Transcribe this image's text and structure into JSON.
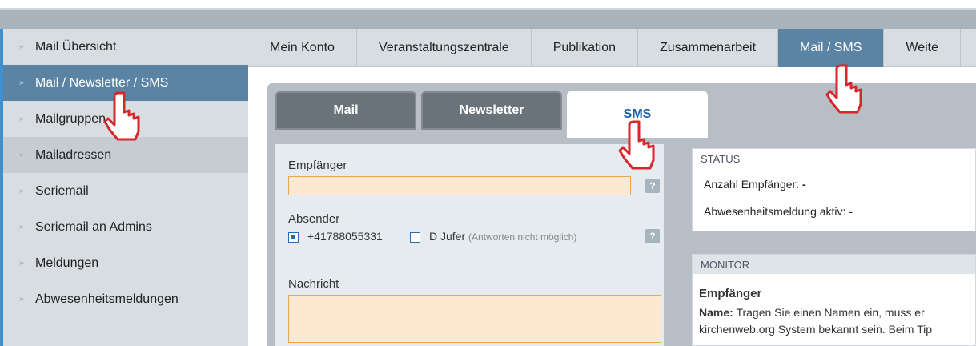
{
  "sidebar": {
    "items": [
      {
        "label": "Mail Übersicht"
      },
      {
        "label": "Mail / Newsletter / SMS"
      },
      {
        "label": "Mailgruppen"
      },
      {
        "label": "Mailadressen"
      },
      {
        "label": "Seriemail"
      },
      {
        "label": "Seriemail an Admins"
      },
      {
        "label": "Meldungen"
      },
      {
        "label": "Abwesenheitsmeldungen"
      }
    ]
  },
  "topnav": {
    "tabs": [
      {
        "label": "Mein Konto"
      },
      {
        "label": "Veranstaltungszentrale"
      },
      {
        "label": "Publikation"
      },
      {
        "label": "Zusammenarbeit"
      },
      {
        "label": "Mail / SMS"
      },
      {
        "label": "Weite"
      }
    ]
  },
  "subtabs": {
    "mail": "Mail",
    "newsletter": "Newsletter",
    "sms": "SMS"
  },
  "form": {
    "recipient_label": "Empfänger",
    "recipient_value": "",
    "sender_label": "Absender",
    "sender_option1": "+41788055331",
    "sender_option2": "D Jufer",
    "sender_option2_hint": "(Antworten nicht möglich)",
    "message_label": "Nachricht",
    "help": "?"
  },
  "status": {
    "heading": "STATUS",
    "recipients_label": "Anzahl Empfänger:",
    "recipients_value": "-",
    "absence_label": "Abwesenheitsmeldung aktiv:",
    "absence_value": "-"
  },
  "monitor": {
    "heading": "MONITOR",
    "title": "Empfänger",
    "name_label": "Name:",
    "line1": "Tragen Sie einen Namen ein, muss er",
    "line2": "kirchenweb.org System bekannt sein. Beim Tip"
  },
  "colors": {
    "accent": "#5b83a3",
    "sms_tab_text": "#1e5fa8",
    "field_fill": "#fde9cf",
    "field_border": "#e7a94c"
  },
  "icons": [
    "hand-pointer-icon",
    "help-icon",
    "double-chevron-icon"
  ]
}
